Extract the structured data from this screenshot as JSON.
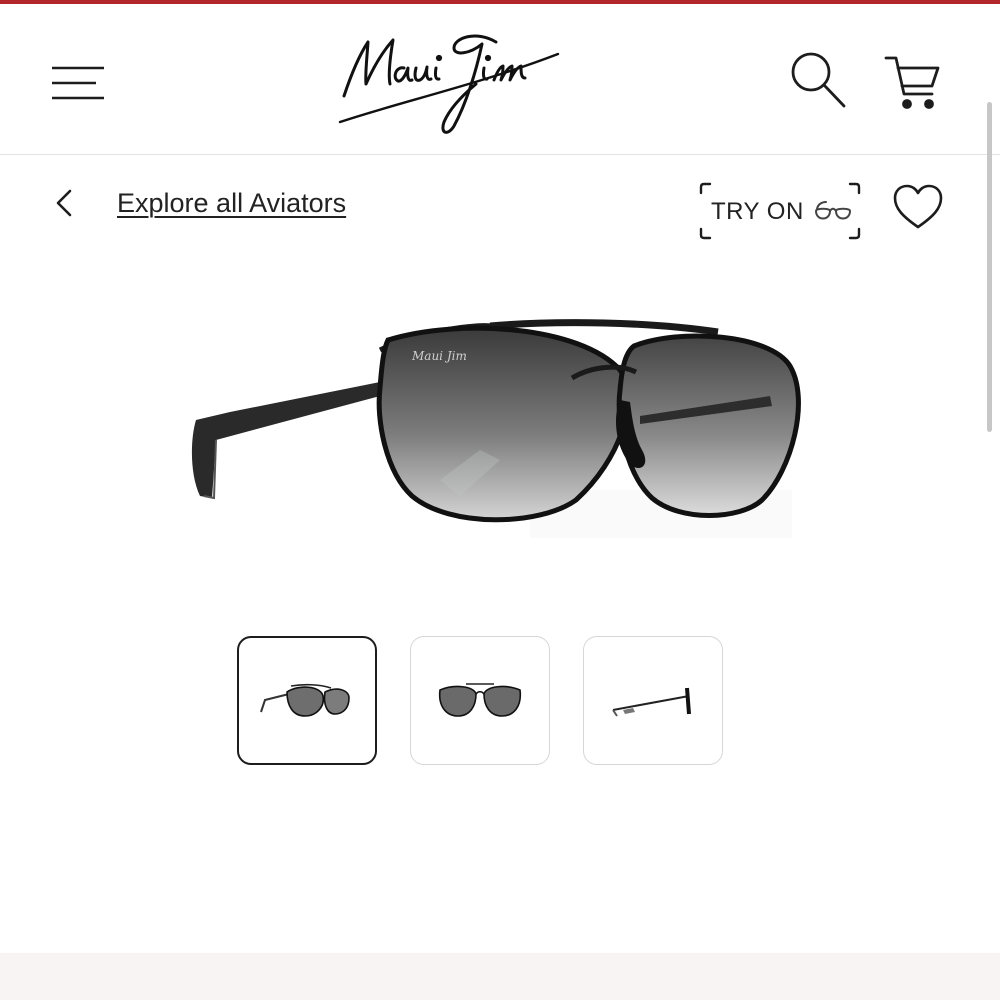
{
  "brand": {
    "name": "Maui Jim",
    "accent_color": "#b3262b"
  },
  "header": {
    "menu_icon": "hamburger-menu-icon",
    "search_icon": "search-icon",
    "cart_icon": "shopping-cart-icon"
  },
  "nav": {
    "back_icon": "chevron-left-icon",
    "back_link_label": "Explore all Aviators"
  },
  "actions": {
    "try_on_label": "TRY ON",
    "try_on_icon": "glasses-icon",
    "wishlist_icon": "heart-icon"
  },
  "gallery": {
    "main_image": "aviator-sunglasses-three-quarter-view",
    "selected_index": 0,
    "thumbnails": [
      {
        "view": "three-quarter"
      },
      {
        "view": "front"
      },
      {
        "view": "side"
      }
    ]
  }
}
